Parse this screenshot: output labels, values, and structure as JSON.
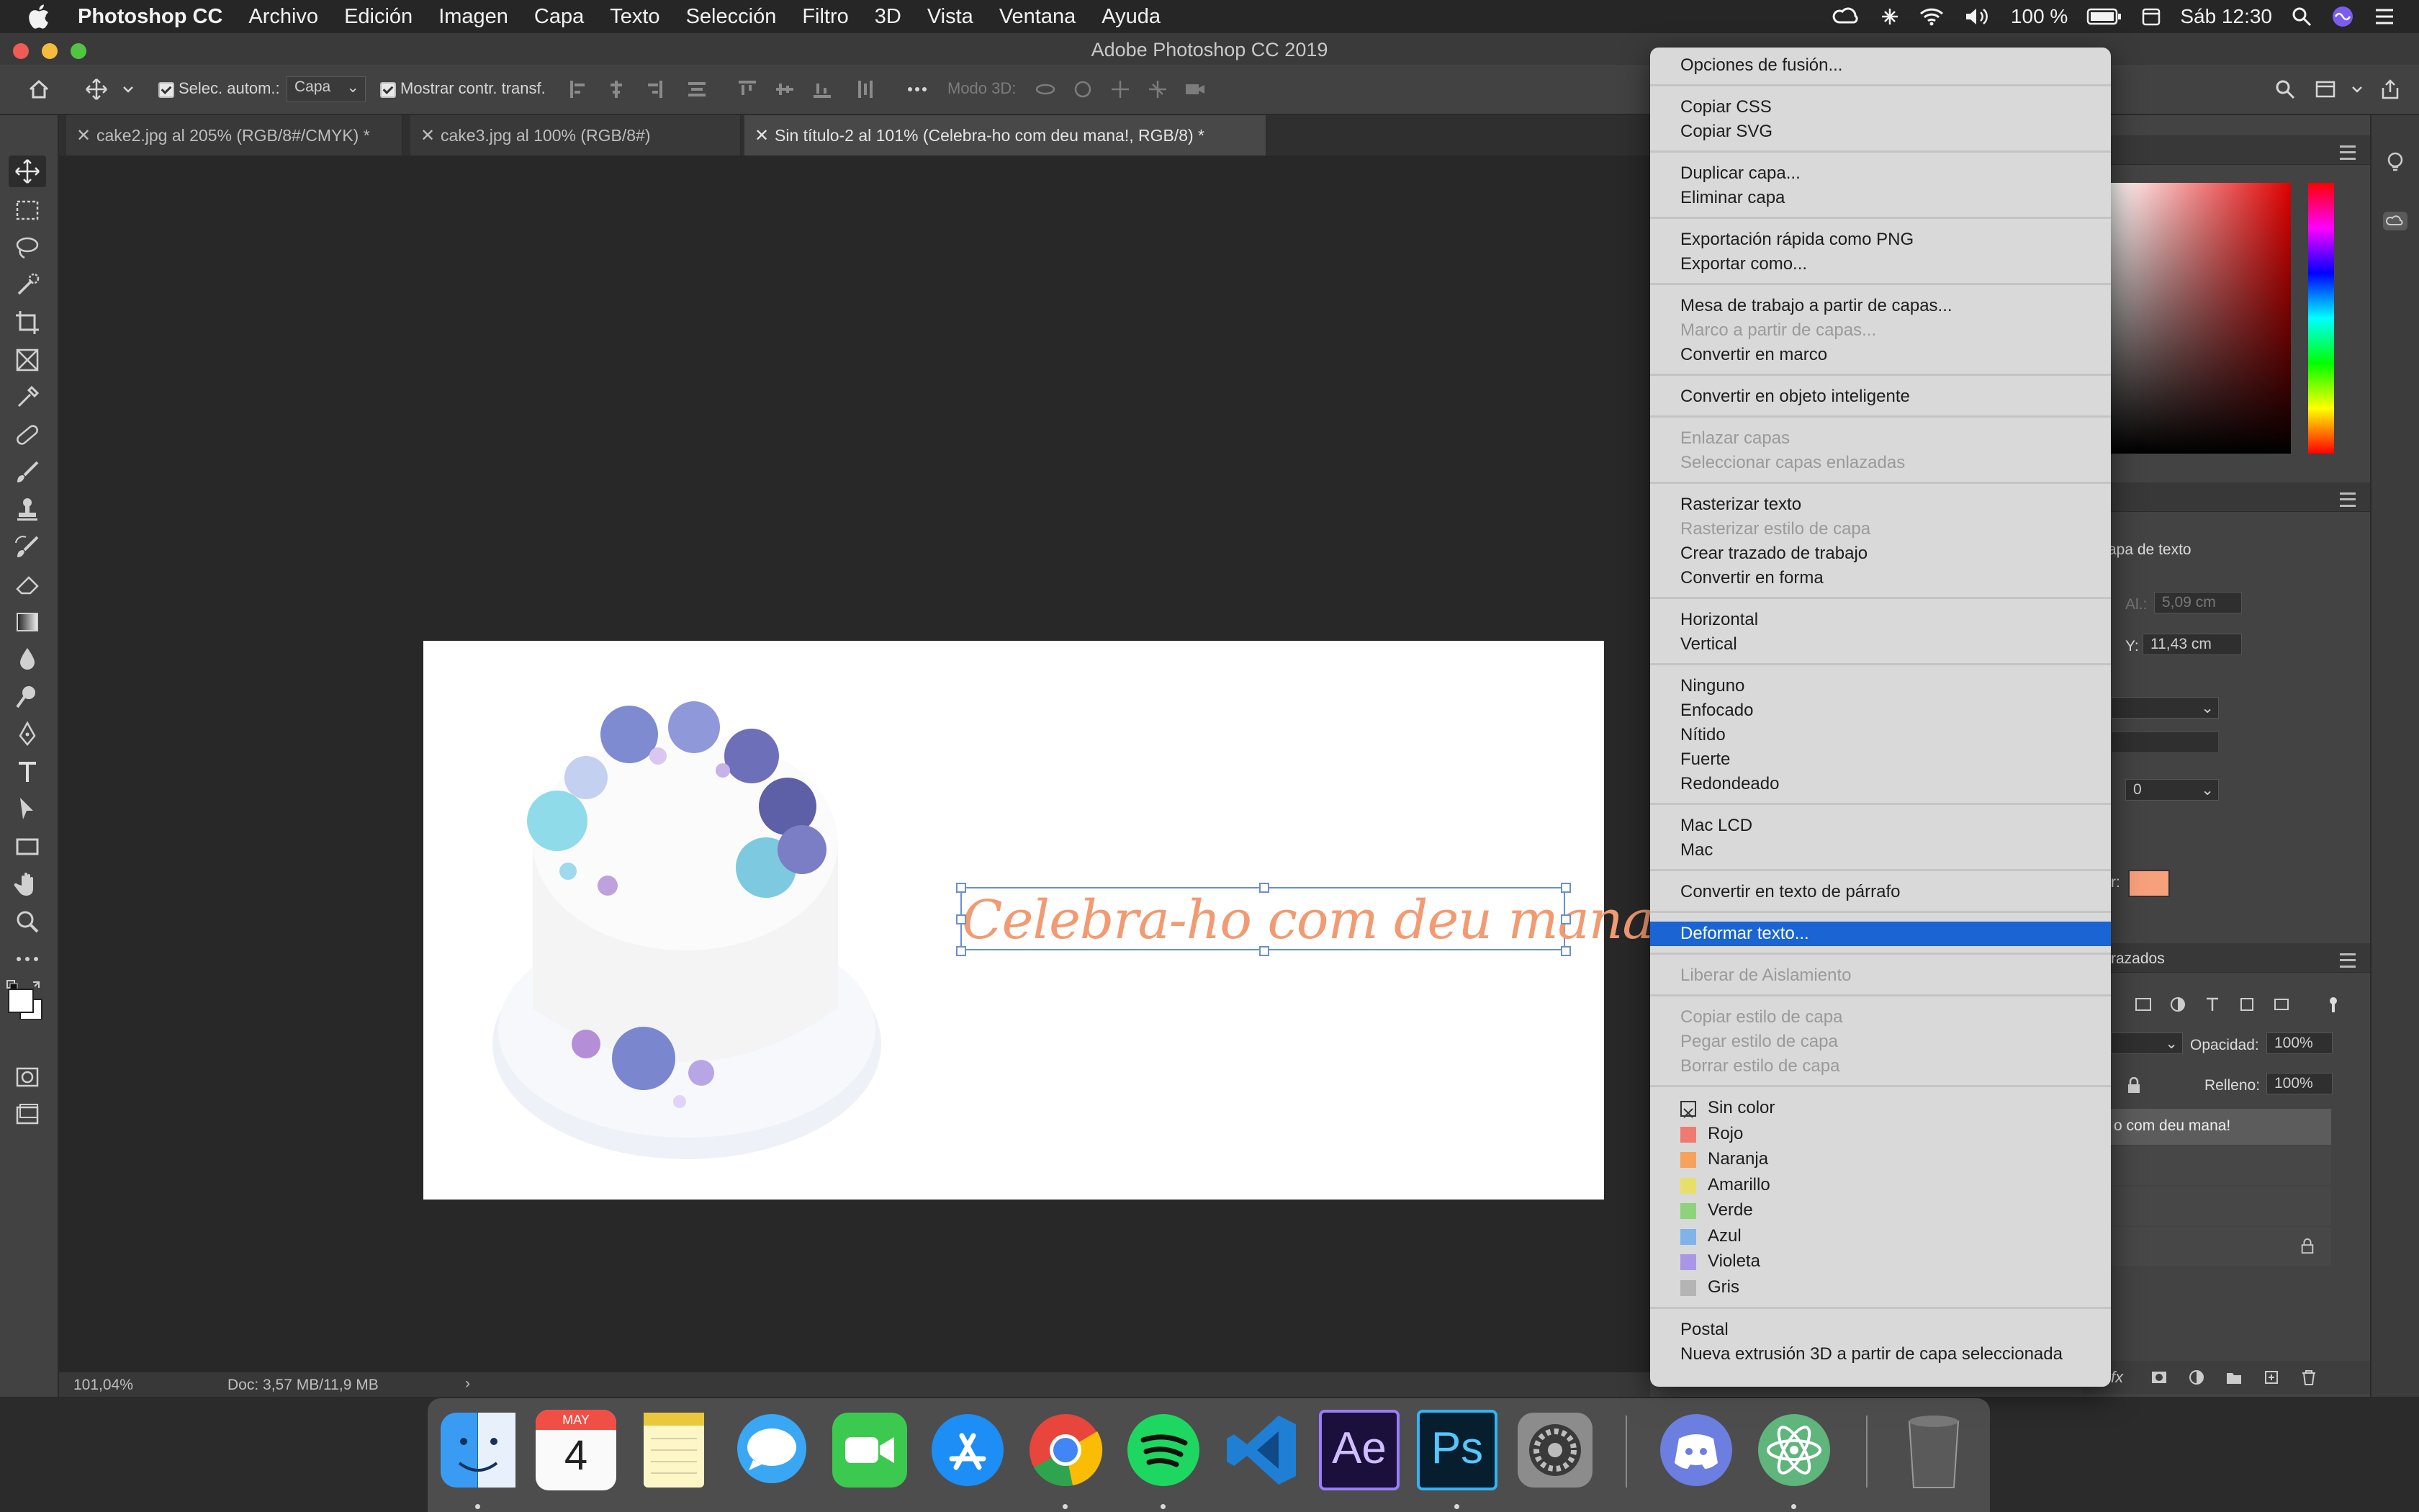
{
  "menubar": {
    "app": "Photoshop CC",
    "items": [
      "Archivo",
      "Edición",
      "Imagen",
      "Capa",
      "Texto",
      "Selección",
      "Filtro",
      "3D",
      "Vista",
      "Ventana",
      "Ayuda"
    ],
    "battery": "100 %",
    "clock": "Sáb 12:30"
  },
  "window": {
    "title": "Adobe Photoshop CC 2019"
  },
  "options": {
    "auto_select_label": "Selec. autom.:",
    "auto_select_value": "Capa",
    "show_transform_label": "Mostrar contr. transf.",
    "mode3d_label": "Modo 3D:"
  },
  "tabs": [
    {
      "label": "cake2.jpg al 205% (RGB/8#/CMYK) *"
    },
    {
      "label": "cake3.jpg al 100% (RGB/8#)"
    },
    {
      "label": "Sin título-2 al 101% (Celebra-ho com deu mana!, RGB/8) *"
    }
  ],
  "canvas": {
    "text_layer": "Celebra-ho com deu mana!"
  },
  "status": {
    "zoom": "101,04%",
    "doc": "Doc: 3,57 MB/11,9 MB"
  },
  "panels": {
    "properties_fragment": "apa de texto",
    "al_label": "Al.:",
    "al_value": "5,09 cm",
    "y_label": "Y:",
    "y_value": "11,43 cm",
    "tracking_value": "0",
    "color_label": "r:",
    "layers_tab_fragment": "razados",
    "opacity_label": "Opacidad:",
    "opacity_value": "100%",
    "fill_label": "Relleno:",
    "fill_value": "100%",
    "layer_name_fragment": "o com deu mana!",
    "fx_label": "fx"
  },
  "context_menu": {
    "groups": [
      [
        {
          "label": "Opciones de fusión...",
          "disabled": false
        }
      ],
      [
        {
          "label": "Copiar CSS",
          "disabled": false
        },
        {
          "label": "Copiar SVG",
          "disabled": false
        }
      ],
      [
        {
          "label": "Duplicar capa...",
          "disabled": false
        },
        {
          "label": "Eliminar capa",
          "disabled": false
        }
      ],
      [
        {
          "label": "Exportación rápida como PNG",
          "disabled": false
        },
        {
          "label": "Exportar como...",
          "disabled": false
        }
      ],
      [
        {
          "label": "Mesa de trabajo a partir de capas...",
          "disabled": false
        },
        {
          "label": "Marco a partir de capas...",
          "disabled": true
        },
        {
          "label": "Convertir en marco",
          "disabled": false
        }
      ],
      [
        {
          "label": "Convertir en objeto inteligente",
          "disabled": false
        }
      ],
      [
        {
          "label": "Enlazar capas",
          "disabled": true
        },
        {
          "label": "Seleccionar capas enlazadas",
          "disabled": true
        }
      ],
      [
        {
          "label": "Rasterizar texto",
          "disabled": false
        },
        {
          "label": "Rasterizar estilo de capa",
          "disabled": true
        },
        {
          "label": "Crear trazado de trabajo",
          "disabled": false
        },
        {
          "label": "Convertir en forma",
          "disabled": false
        }
      ],
      [
        {
          "label": "Horizontal",
          "disabled": false
        },
        {
          "label": "Vertical",
          "disabled": false
        }
      ],
      [
        {
          "label": "Ninguno",
          "disabled": false
        },
        {
          "label": "Enfocado",
          "disabled": false
        },
        {
          "label": "Nítido",
          "disabled": false
        },
        {
          "label": "Fuerte",
          "disabled": false
        },
        {
          "label": "Redondeado",
          "disabled": false
        }
      ],
      [
        {
          "label": "Mac LCD",
          "disabled": false
        },
        {
          "label": "Mac",
          "disabled": false
        }
      ],
      [
        {
          "label": "Convertir en texto de párrafo",
          "disabled": false
        }
      ],
      [
        {
          "label": "Deformar texto...",
          "disabled": false,
          "highlighted": true
        }
      ],
      [
        {
          "label": "Liberar de Aislamiento",
          "disabled": true
        }
      ],
      [
        {
          "label": "Copiar estilo de capa",
          "disabled": true
        },
        {
          "label": "Pegar estilo de capa",
          "disabled": true
        },
        {
          "label": "Borrar estilo de capa",
          "disabled": true
        }
      ]
    ],
    "colors": [
      {
        "label": "Sin color",
        "color": "none"
      },
      {
        "label": "Rojo",
        "color": "#f07a72"
      },
      {
        "label": "Naranja",
        "color": "#f5a35c"
      },
      {
        "label": "Amarillo",
        "color": "#e8df6a"
      },
      {
        "label": "Verde",
        "color": "#8ed27c"
      },
      {
        "label": "Azul",
        "color": "#7fb3ea"
      },
      {
        "label": "Violeta",
        "color": "#a996e4"
      },
      {
        "label": "Gris",
        "color": "#b4b4b4"
      }
    ],
    "footer": [
      {
        "label": "Postal",
        "disabled": false
      },
      {
        "label": "Nueva extrusión 3D a partir de capa seleccionada",
        "disabled": false
      }
    ]
  },
  "dock": {
    "apps": [
      "Finder",
      "Calendario",
      "Notas",
      "Mensajes",
      "FaceTime",
      "App Store",
      "Chrome",
      "Spotify",
      "Visual Studio Code",
      "After Effects",
      "Photoshop",
      "Preferencias del Sistema",
      "Discord",
      "Atom",
      "Papelera"
    ],
    "calendar_month": "MAY",
    "calendar_day": "4",
    "ae_label": "Ae",
    "ps_label": "Ps"
  },
  "colors": {
    "accent_highlight": "#1a64d3",
    "text_layer_color": "#f29a72",
    "swatch_foreground": "#ffffff"
  }
}
